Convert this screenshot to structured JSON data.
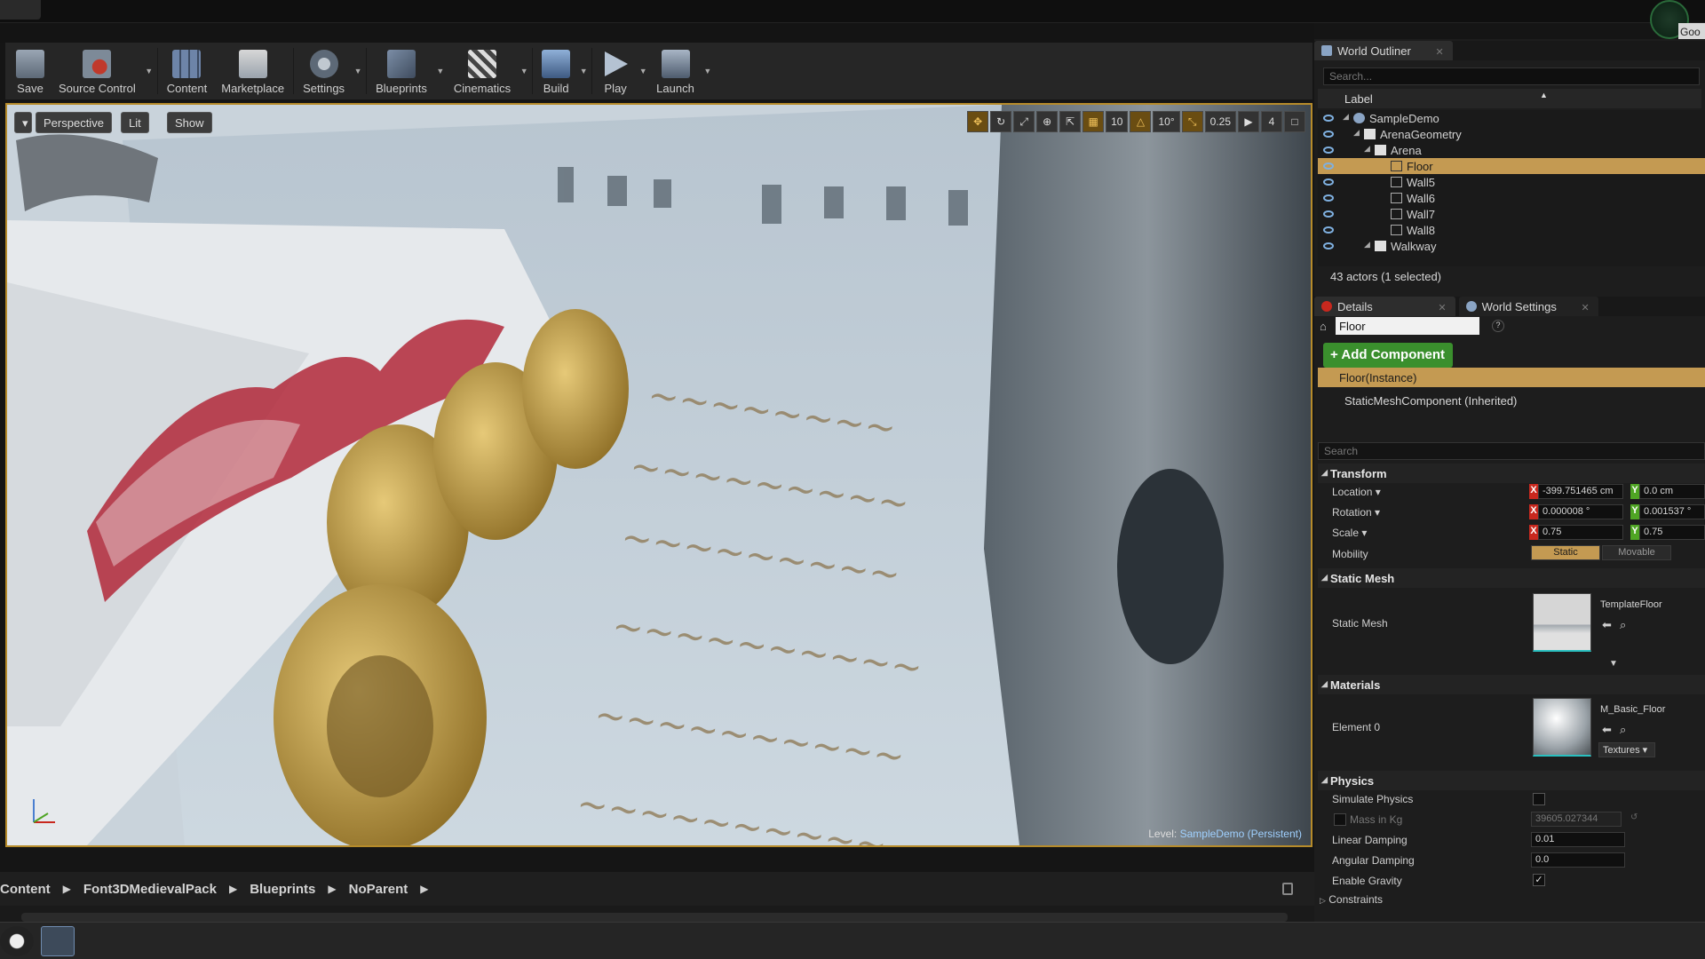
{
  "topbar": {
    "corner_text": "Goo"
  },
  "toolbar": {
    "buttons": [
      {
        "label": "Save",
        "icon": "save-icon"
      },
      {
        "label": "Source Control",
        "icon": "source-control-icon"
      },
      {
        "label": "Content",
        "icon": "content-icon"
      },
      {
        "label": "Marketplace",
        "icon": "marketplace-icon"
      },
      {
        "label": "Settings",
        "icon": "settings-icon"
      },
      {
        "label": "Blueprints",
        "icon": "blueprints-icon"
      },
      {
        "label": "Cinematics",
        "icon": "cinematics-icon"
      },
      {
        "label": "Build",
        "icon": "build-icon"
      },
      {
        "label": "Play",
        "icon": "play-icon"
      },
      {
        "label": "Launch",
        "icon": "launch-icon"
      }
    ]
  },
  "viewport": {
    "perspective_label": "Perspective",
    "lit_label": "Lit",
    "show_label": "Show",
    "grid_snap": "10",
    "rot_snap": "10°",
    "scale_snap": "0.25",
    "camera_speed": "4",
    "level_prefix": "Level:",
    "level_name": "SampleDemo (Persistent)"
  },
  "content_browser": {
    "breadcrumbs": [
      "Content",
      "Font3DMedievalPack",
      "Blueprints",
      "NoParent"
    ]
  },
  "world_outliner": {
    "tab_label": "World Outliner",
    "search_placeholder": "Search...",
    "column_label": "Label",
    "rows": [
      {
        "label": "SampleDemo",
        "depth": 0,
        "selected": false,
        "type": "world"
      },
      {
        "label": "ArenaGeometry",
        "depth": 1,
        "selected": false,
        "type": "folder"
      },
      {
        "label": "Arena",
        "depth": 2,
        "selected": false,
        "type": "folder"
      },
      {
        "label": "Floor",
        "depth": 3,
        "selected": true,
        "type": "actor"
      },
      {
        "label": "Wall5",
        "depth": 3,
        "selected": false,
        "type": "actor"
      },
      {
        "label": "Wall6",
        "depth": 3,
        "selected": false,
        "type": "actor"
      },
      {
        "label": "Wall7",
        "depth": 3,
        "selected": false,
        "type": "actor"
      },
      {
        "label": "Wall8",
        "depth": 3,
        "selected": false,
        "type": "actor"
      },
      {
        "label": "Walkway",
        "depth": 2,
        "selected": false,
        "type": "folder"
      }
    ],
    "actor_count": "43 actors (1 selected)"
  },
  "details": {
    "tab_label": "Details",
    "world_settings_label": "World Settings",
    "actor_name": "Floor",
    "add_component_label": "+ Add Component",
    "instance_label": "Floor(Instance)",
    "component_label": "StaticMeshComponent (Inherited)",
    "search_placeholder": "Search",
    "transform": {
      "section": "Transform",
      "location_label": "Location",
      "location_x": "-399.751465 cm",
      "location_y": "0.0 cm",
      "rotation_label": "Rotation",
      "rotation_x": "0.000008 °",
      "rotation_y": "0.001537 °",
      "scale_label": "Scale",
      "scale_x": "0.75",
      "scale_y": "0.75",
      "mobility_label": "Mobility",
      "mobility_static": "Static",
      "mobility_movable": "Movable"
    },
    "static_mesh": {
      "section": "Static Mesh",
      "label": "Static Mesh",
      "value": "TemplateFloor"
    },
    "materials": {
      "section": "Materials",
      "element_label": "Element 0",
      "value": "M_Basic_Floor",
      "textures_label": "Textures"
    },
    "physics": {
      "section": "Physics",
      "simulate_label": "Simulate Physics",
      "mass_label": "Mass in Kg",
      "mass_value": "39605.027344",
      "linear_label": "Linear Damping",
      "linear_value": "0.01",
      "angular_label": "Angular Damping",
      "angular_value": "0.0",
      "gravity_label": "Enable Gravity",
      "constraints_label": "Constraints"
    }
  },
  "colors": {
    "selection": "#c49a52",
    "viewport_border": "#b68b2a",
    "add_component": "#3a8f2d",
    "axis_x": "#c8281e",
    "axis_y": "#4fa524"
  }
}
